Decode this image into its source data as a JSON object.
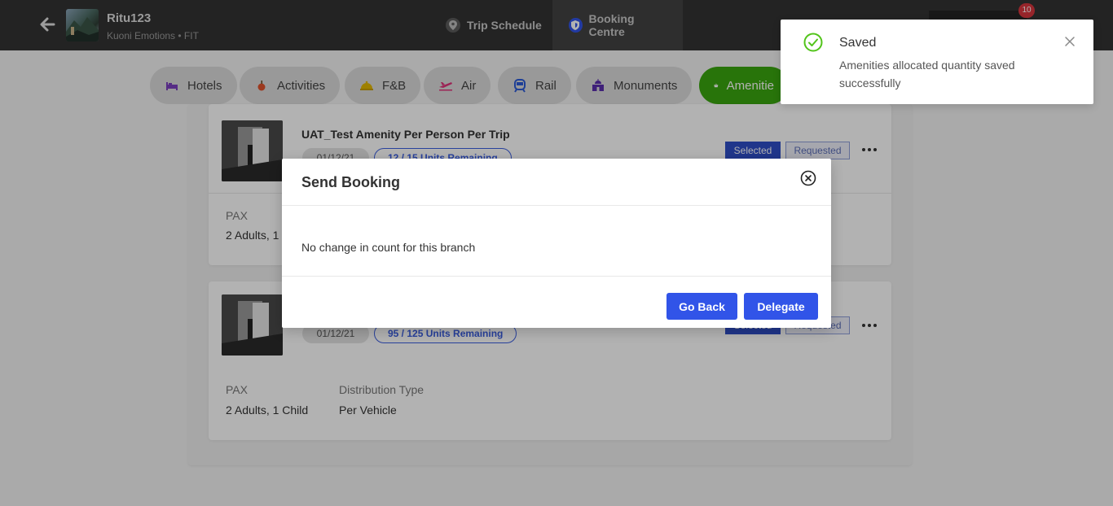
{
  "header": {
    "user_name": "Ritu123",
    "user_subtitle": "Kuoni Emotions • FIT",
    "tabs": [
      {
        "label": "Trip Schedule",
        "icon": "location-pin-icon"
      },
      {
        "label": "Booking Centre",
        "icon": "shield-icon"
      }
    ],
    "notification_count": "10"
  },
  "categories": [
    {
      "label": "Hotels",
      "icon": "bed-icon",
      "color": "#7b3fbf"
    },
    {
      "label": "Activities",
      "icon": "apple-icon",
      "color": "#e0522b"
    },
    {
      "label": "F&B",
      "icon": "cloche-icon",
      "color": "#e3b800"
    },
    {
      "label": "Air",
      "icon": "plane-icon",
      "color": "#e0337a"
    },
    {
      "label": "Rail",
      "icon": "train-icon",
      "color": "#2b5bd7"
    },
    {
      "label": "Monuments",
      "icon": "monument-icon",
      "color": "#5b2fae"
    },
    {
      "label": "Amenitie",
      "icon": "basket-icon",
      "color": "#ffffff"
    }
  ],
  "cards": [
    {
      "title": "UAT_Test Amenity Per Person Per Trip",
      "date": "01/12/21",
      "units": "12 / 15 Units Remaining",
      "status_selected": "Selected",
      "status_requested": "Requested",
      "pax_label": "PAX",
      "pax_value": "2 Adults, 1",
      "dist_label": "",
      "dist_value": ""
    },
    {
      "title": "",
      "date": "01/12/21",
      "units": "95 / 125 Units Remaining",
      "status_selected": "Selected",
      "status_requested": "Requested",
      "pax_label": "PAX",
      "pax_value": "2 Adults, 1 Child",
      "dist_label": "Distribution Type",
      "dist_value": "Per Vehicle"
    }
  ],
  "modal": {
    "title": "Send Booking",
    "body": "No change in count for this branch",
    "go_back_label": "Go Back",
    "delegate_label": "Delegate"
  },
  "toast": {
    "title": "Saved",
    "message": "Amenities allocated quantity saved successfully"
  },
  "colors": {
    "primary": "#3154e8",
    "success": "#52c41a",
    "active_pill": "#3aa60f",
    "topbar": "#333333"
  }
}
